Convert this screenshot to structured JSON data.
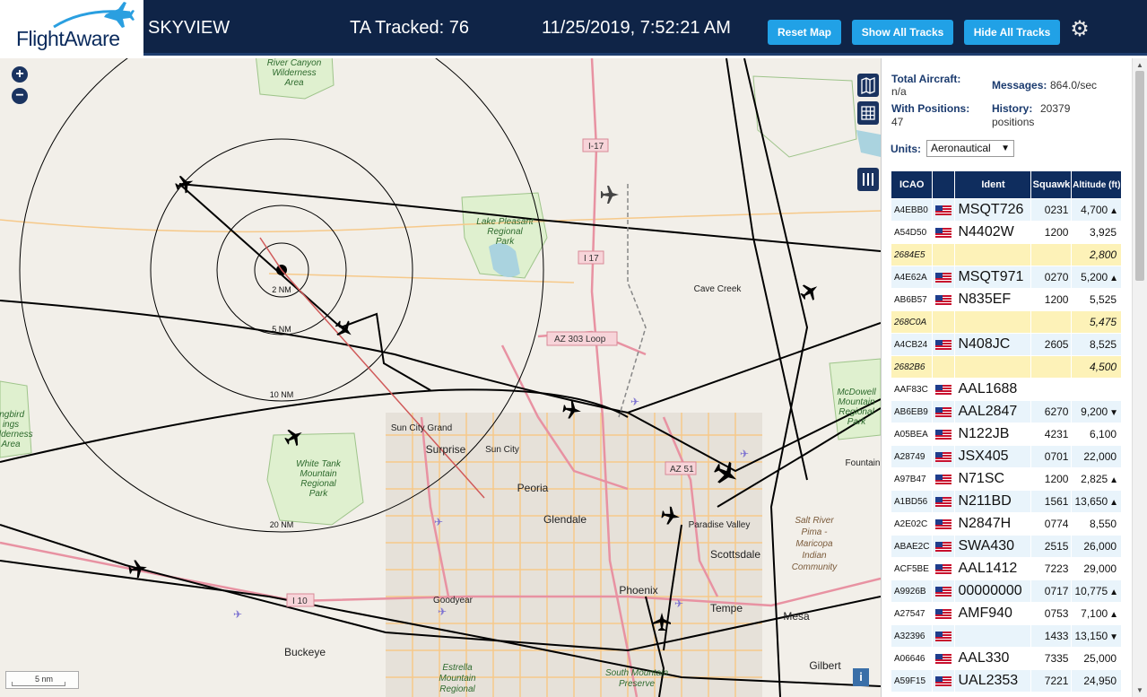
{
  "header": {
    "logo_text": "FlightAware",
    "site_name": "SKYVIEW",
    "ta_tracked": "TA Tracked: 76",
    "datetime": "11/25/2019, 7:52:21 AM",
    "buttons": {
      "reset_map": "Reset Map",
      "show_all_tracks": "Show All Tracks",
      "hide_all_tracks": "Hide All Tracks"
    },
    "settings_icon": "gear-icon"
  },
  "map": {
    "zoom_in": "+",
    "zoom_out": "−",
    "scale_text": "5 nm",
    "info_icon": "i",
    "range_rings": [
      "2 NM",
      "5 NM",
      "10 NM",
      "20 NM"
    ],
    "places": [
      "River Canyon Wilderness Area",
      "Lake Pleasant Regional Park",
      "Cave Creek",
      "Sun City Grand",
      "Surprise",
      "Sun City",
      "Peoria",
      "Glendale",
      "White Tank Mountain Regional Park",
      "Paradise Valley",
      "Scottsdale",
      "Phoenix",
      "Tempe",
      "Mesa",
      "Goodyear",
      "Buckeye",
      "Gilbert",
      "McDowell Mountain Regional Park",
      "Fountain",
      "Salt River Pima - Maricopa Indian Community",
      "Estrella Mountain Regional",
      "South Mountain Preserve",
      "ingbird ings Wilderness Area"
    ],
    "road_shields": [
      "I-17",
      "I 17",
      "AZ 303 Loop",
      "AZ 51",
      "I 10"
    ]
  },
  "stats": {
    "total_aircraft_label": "Total Aircraft:",
    "total_aircraft_value": "n/a",
    "messages_label": "Messages:",
    "messages_value": "864.0/sec",
    "with_positions_label": "With Positions:",
    "with_positions_value": "47",
    "history_label": "History:",
    "history_value": "20379",
    "history_unit": "positions",
    "units_label": "Units:",
    "units_value": "Aeronautical"
  },
  "table": {
    "headers": [
      "ICAO",
      "",
      "Ident",
      "Squawk",
      "Altitude (ft)"
    ],
    "rows": [
      {
        "icao": "A4EBB0",
        "flag": true,
        "ident": "MSQT726",
        "squawk": "0231",
        "altitude": "4,700",
        "trend": "▲",
        "type": "odd"
      },
      {
        "icao": "A54D50",
        "flag": true,
        "ident": "N4402W",
        "squawk": "1200",
        "altitude": "3,925",
        "trend": "",
        "type": "even"
      },
      {
        "icao": "2684E5",
        "flag": false,
        "ident": "",
        "squawk": "",
        "altitude": "2,800",
        "trend": "",
        "type": "tisb"
      },
      {
        "icao": "A4E62A",
        "flag": true,
        "ident": "MSQT971",
        "squawk": "0270",
        "altitude": "5,200",
        "trend": "▲",
        "type": "odd"
      },
      {
        "icao": "AB6B57",
        "flag": true,
        "ident": "N835EF",
        "squawk": "1200",
        "altitude": "5,525",
        "trend": "",
        "type": "even"
      },
      {
        "icao": "268C0A",
        "flag": false,
        "ident": "",
        "squawk": "",
        "altitude": "5,475",
        "trend": "",
        "type": "tisb"
      },
      {
        "icao": "A4CB24",
        "flag": true,
        "ident": "N408JC",
        "squawk": "2605",
        "altitude": "8,525",
        "trend": "",
        "type": "odd"
      },
      {
        "icao": "2682B6",
        "flag": false,
        "ident": "",
        "squawk": "",
        "altitude": "4,500",
        "trend": "",
        "type": "tisb"
      },
      {
        "icao": "AAF83C",
        "flag": true,
        "ident": "AAL1688",
        "squawk": "",
        "altitude": "",
        "trend": "",
        "type": "even"
      },
      {
        "icao": "AB6EB9",
        "flag": true,
        "ident": "AAL2847",
        "squawk": "6270",
        "altitude": "9,200",
        "trend": "▼",
        "type": "odd"
      },
      {
        "icao": "A05BEA",
        "flag": true,
        "ident": "N122JB",
        "squawk": "4231",
        "altitude": "6,100",
        "trend": "",
        "type": "even"
      },
      {
        "icao": "A28749",
        "flag": true,
        "ident": "JSX405",
        "squawk": "0701",
        "altitude": "22,000",
        "trend": "",
        "type": "odd"
      },
      {
        "icao": "A97B47",
        "flag": true,
        "ident": "N71SC",
        "squawk": "1200",
        "altitude": "2,825",
        "trend": "▲",
        "type": "even"
      },
      {
        "icao": "A1BD56",
        "flag": true,
        "ident": "N211BD",
        "squawk": "1561",
        "altitude": "13,650",
        "trend": "▲",
        "type": "odd"
      },
      {
        "icao": "A2E02C",
        "flag": true,
        "ident": "N2847H",
        "squawk": "0774",
        "altitude": "8,550",
        "trend": "",
        "type": "even"
      },
      {
        "icao": "ABAE2C",
        "flag": true,
        "ident": "SWA430",
        "squawk": "2515",
        "altitude": "26,000",
        "trend": "",
        "type": "odd"
      },
      {
        "icao": "ACF5BE",
        "flag": true,
        "ident": "AAL1412",
        "squawk": "7223",
        "altitude": "29,000",
        "trend": "",
        "type": "even"
      },
      {
        "icao": "A9926B",
        "flag": true,
        "ident": "00000000",
        "squawk": "0717",
        "altitude": "10,775",
        "trend": "▲",
        "type": "odd"
      },
      {
        "icao": "A27547",
        "flag": true,
        "ident": "AMF940",
        "squawk": "0753",
        "altitude": "7,100",
        "trend": "▲",
        "type": "even"
      },
      {
        "icao": "A32396",
        "flag": true,
        "ident": "",
        "squawk": "1433",
        "altitude": "13,150",
        "trend": "▼",
        "type": "odd"
      },
      {
        "icao": "A06646",
        "flag": true,
        "ident": "AAL330",
        "squawk": "7335",
        "altitude": "25,000",
        "trend": "",
        "type": "even"
      },
      {
        "icao": "A59F15",
        "flag": true,
        "ident": "UAL2353",
        "squawk": "7221",
        "altitude": "24,950",
        "trend": "",
        "type": "odd"
      }
    ]
  }
}
